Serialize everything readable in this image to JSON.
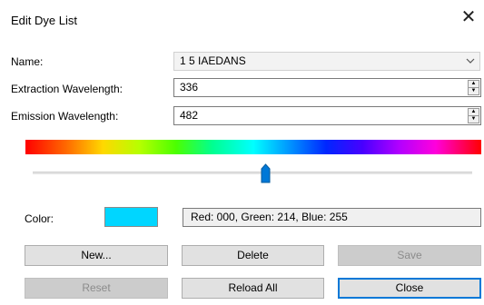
{
  "window": {
    "title": "Edit Dye List",
    "close_glyph": "✕"
  },
  "form": {
    "name_label": "Name:",
    "name_value": "1 5 IAEDANS",
    "extraction_label": "Extraction Wavelength:",
    "extraction_value": "336",
    "emission_label": "Emission Wavelength:",
    "emission_value": "482"
  },
  "slider": {
    "level": 0.53
  },
  "color": {
    "label": "Color:",
    "swatch_hex": "#00d6ff",
    "rgb_text": "Red: 000, Green: 214, Blue: 255"
  },
  "buttons": {
    "new": "New...",
    "delete": "Delete",
    "save": "Save",
    "reset": "Reset",
    "reload_all": "Reload All",
    "close": "Close"
  }
}
